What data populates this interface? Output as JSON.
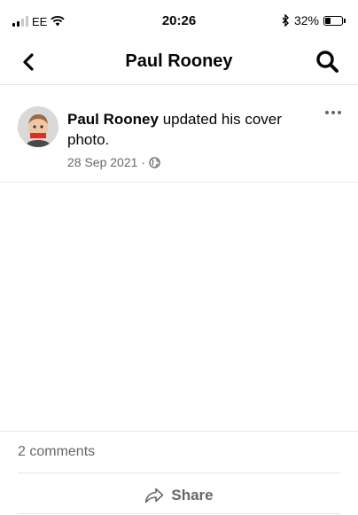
{
  "status_bar": {
    "carrier": "EE",
    "time": "20:26",
    "battery_percent": "32%",
    "battery_level": 0.32,
    "icons": [
      "signal-icon",
      "wifi-icon",
      "bluetooth-icon",
      "battery-icon"
    ]
  },
  "nav": {
    "title": "Paul Rooney",
    "back_icon": "chevron-left-icon",
    "search_icon": "search-icon"
  },
  "post": {
    "author": "Paul Rooney",
    "action": " updated his cover photo.",
    "date": "28 Sep 2021 ·",
    "audience_icon": "globe-icon",
    "more_icon": "more-icon"
  },
  "footer": {
    "comments": "2 comments",
    "share_label": "Share",
    "share_icon": "share-arrow-icon"
  },
  "colors": {
    "text": "#050505",
    "secondary": "#65676b",
    "divider": "#e6e6e6",
    "background": "#ffffff"
  }
}
